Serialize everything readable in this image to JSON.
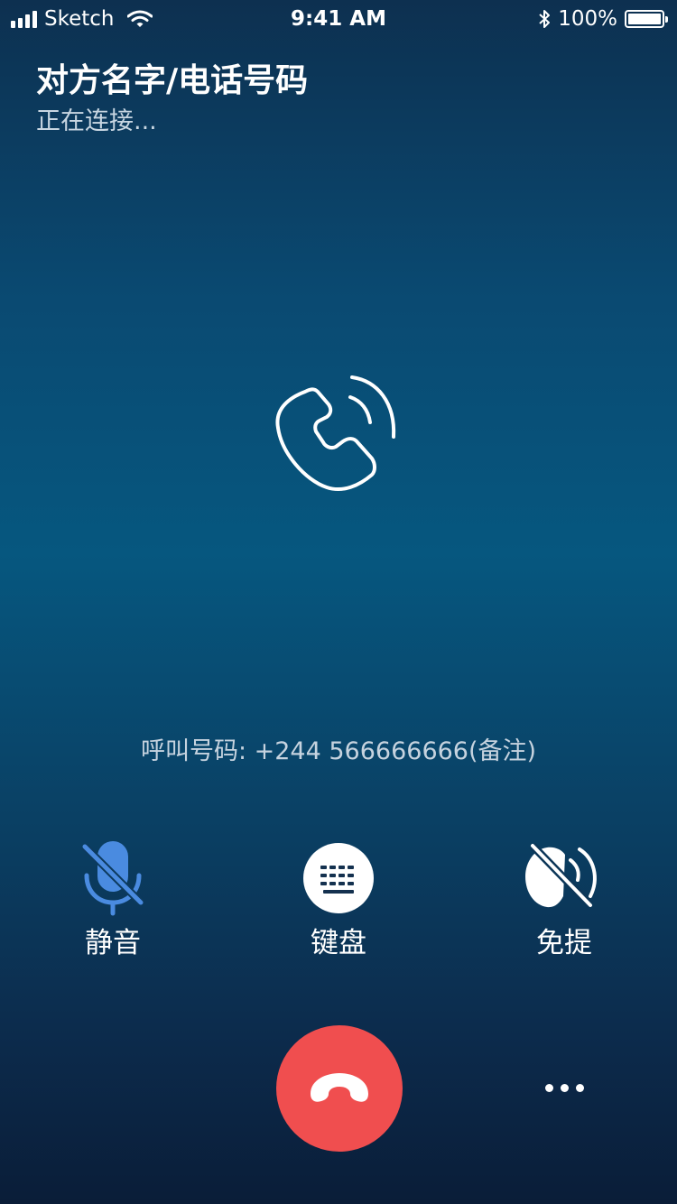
{
  "status_bar": {
    "carrier": "Sketch",
    "time": "9:41 AM",
    "battery": "100%",
    "battery_level": 1.0
  },
  "caller": {
    "name": "对方名字/电话号码",
    "status": "正在连接..."
  },
  "call_number": "呼叫号码: +244 566666666(备注)",
  "controls": [
    {
      "label": "静音",
      "icon": "microphone-off-icon"
    },
    {
      "label": "键盘",
      "icon": "keypad-icon"
    },
    {
      "label": "免提",
      "icon": "speaker-off-icon"
    }
  ],
  "colors": {
    "hangup": "#f04e4f",
    "mute_accent": "#4a8be0"
  },
  "icons": {
    "center": "phone-ringing-icon",
    "hangup": "hang-up-icon",
    "more": "more-icon"
  }
}
